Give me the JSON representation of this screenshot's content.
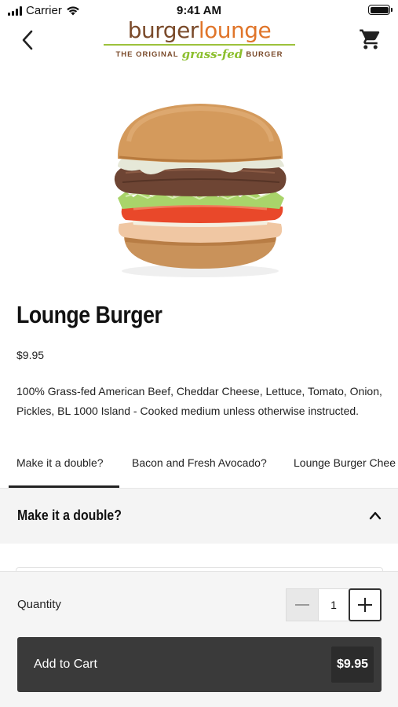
{
  "status_bar": {
    "carrier": "Carrier",
    "time": "9:41 AM"
  },
  "header": {
    "logo_word1": "burger",
    "logo_word2": "lounge",
    "logo_tagline_start": "THE ORIGINAL",
    "logo_tagline_accent": "grass-fed",
    "logo_tagline_end": "BURGER",
    "back_icon": "chevron-left-icon",
    "cart_icon": "cart-icon"
  },
  "product": {
    "title": "Lounge Burger",
    "price": "$9.95",
    "description": "100% Grass-fed American Beef, Cheddar Cheese, Lettuce, Tomato, Onion, Pickles, BL 1000 Island - Cooked medium unless otherwise instructed."
  },
  "tabs": [
    {
      "label": "Make it a double?",
      "active": true
    },
    {
      "label": "Bacon and Fresh Avocado?",
      "active": false
    },
    {
      "label": "Lounge Burger Chee",
      "active": false
    }
  ],
  "section": {
    "title": "Make it a double?",
    "expanded": true
  },
  "order": {
    "quantity_label": "Quantity",
    "quantity": "1",
    "add_label": "Add to Cart",
    "add_price": "$9.95"
  },
  "colors": {
    "logo_brown": "#7a4a2a",
    "logo_orange": "#e0752a",
    "logo_green": "#8cbf2e",
    "button_dark": "#3a3a3a"
  }
}
